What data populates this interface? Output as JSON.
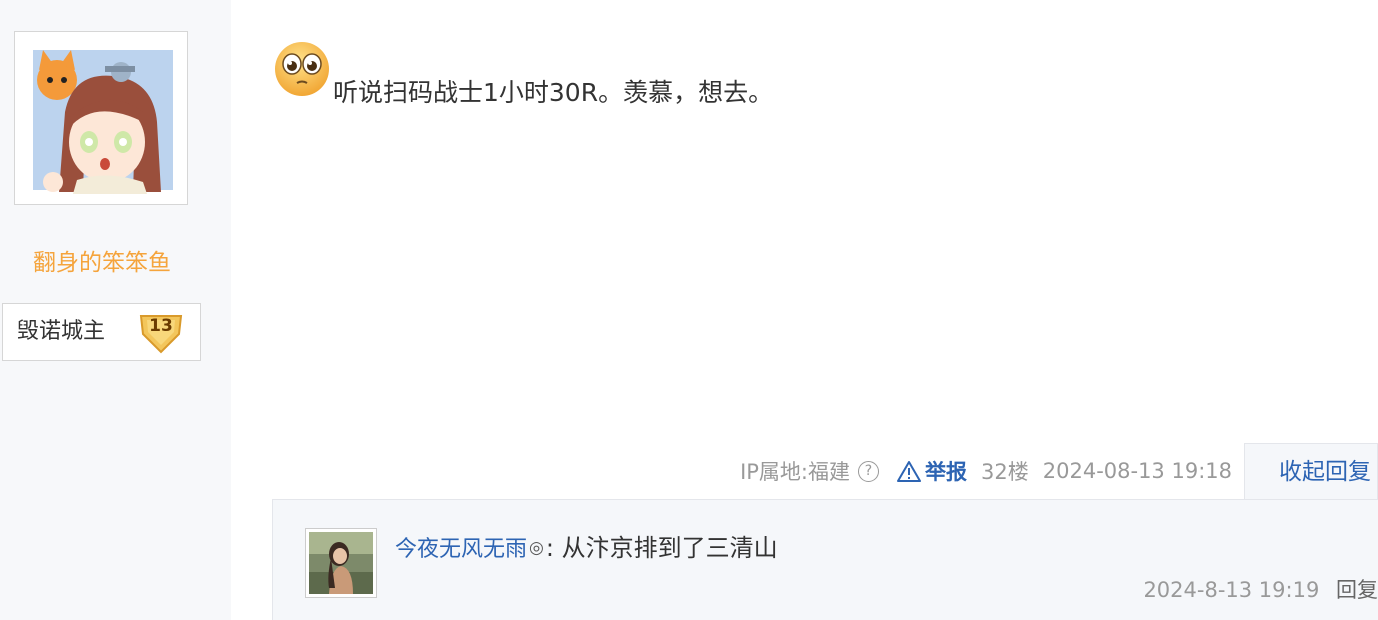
{
  "author": {
    "username": "翻身的笨笨鱼",
    "rank_title": "毁诺城主",
    "level": "13",
    "avatar_icon": "anime-girl-avatar"
  },
  "post": {
    "emoji_icon": "pleading-face-emoji",
    "text": "听说扫码战士1小时30R。羡慕，想去。"
  },
  "meta": {
    "ip_location": "IP属地:福建",
    "help_glyph": "?",
    "report_label": "举报",
    "floor": "32楼",
    "timestamp": "2024-08-13 19:18",
    "collapse_label": "收起回复"
  },
  "replies": [
    {
      "username": "今夜无风无雨",
      "mark": "◎",
      "separator": ":",
      "text": " 从汴京排到了三清山",
      "timestamp": "2024-8-13 19:19",
      "reply_label": "回复"
    }
  ],
  "colors": {
    "username": "#f5a43c",
    "link": "#2d64b3",
    "meta": "#999999",
    "sidebar_bg": "#f7f8fa",
    "reply_bg": "#f5f7fa"
  }
}
